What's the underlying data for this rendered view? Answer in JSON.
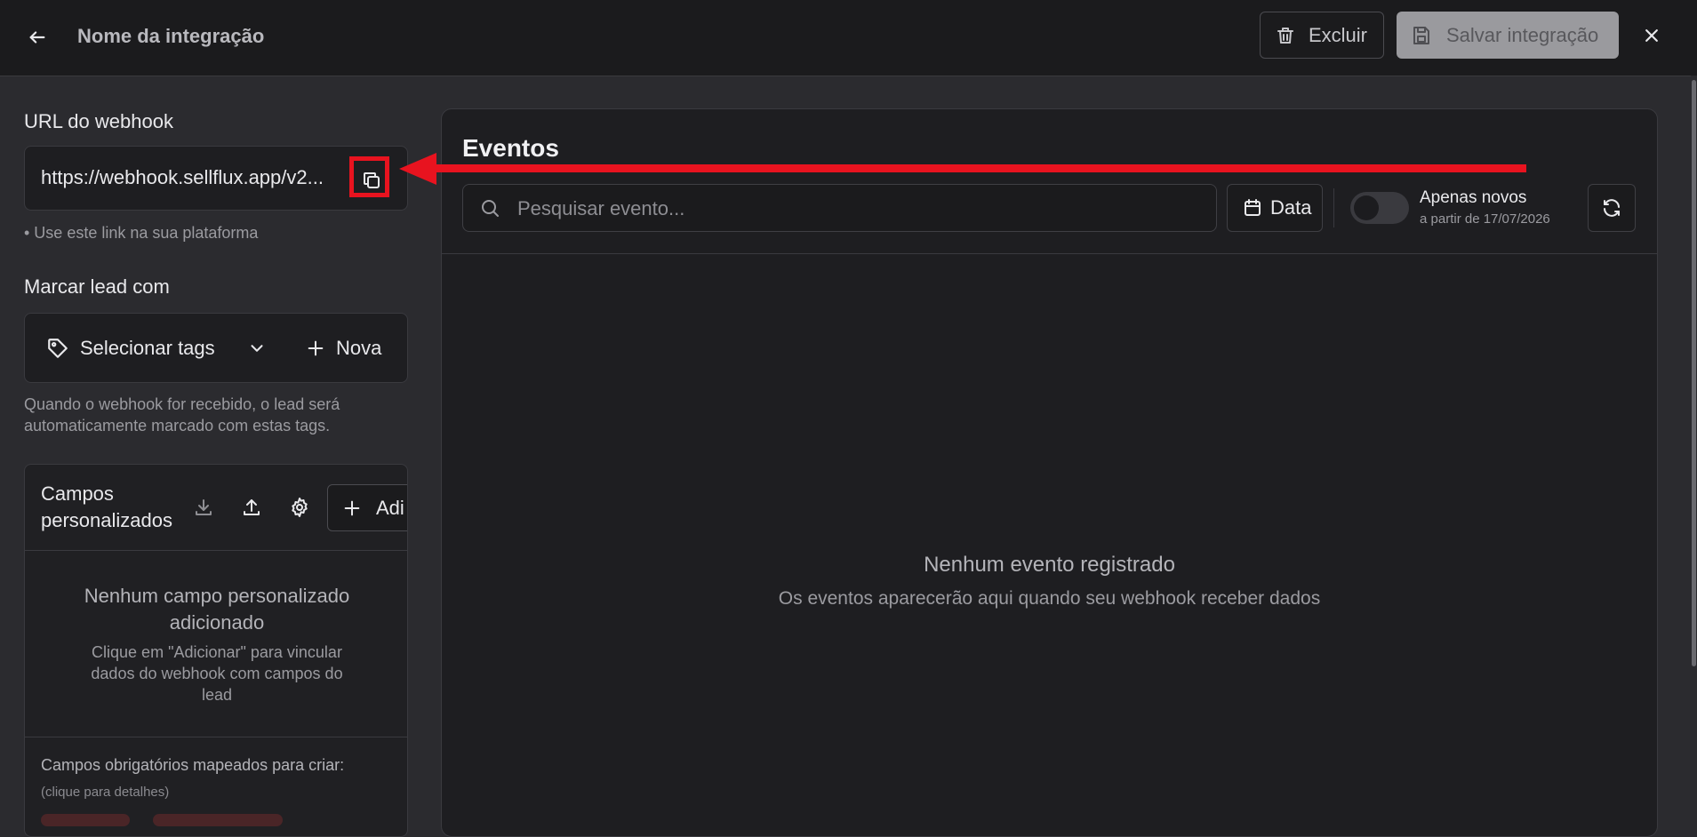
{
  "header": {
    "title": "Nome da integração",
    "delete_label": "Excluir",
    "save_label": "Salvar integração"
  },
  "webhook": {
    "label": "URL do webhook",
    "url": "https://webhook.sellflux.app/v2...",
    "hint": "• Use este link na sua plataforma"
  },
  "tags": {
    "label": "Marcar lead com",
    "select_label": "Selecionar tags",
    "new_label": "Nova",
    "hint_line1": "Quando o webhook for recebido, o lead será",
    "hint_line2": "automaticamente marcado com estas tags."
  },
  "custom_fields": {
    "title_line1": "Campos",
    "title_line2": "personalizados",
    "add_label": "Adi",
    "empty_title_line1": "Nenhum campo personalizado",
    "empty_title_line2": "adicionado",
    "empty_sub_line1": "Clique em \"Adicionar\" para vincular",
    "empty_sub_line2": "dados do webhook com campos do",
    "empty_sub_line3": "lead",
    "required_text": "Campos obrigatórios mapeados para criar:",
    "required_hint": "(clique para detalhes)"
  },
  "events": {
    "title": "Eventos",
    "search_placeholder": "Pesquisar evento...",
    "date_label": "Data",
    "toggle_label": "Apenas novos",
    "toggle_sub": "a partir de 17/07/2026",
    "toggle_on": false,
    "empty_title": "Nenhum evento registrado",
    "empty_sub": "Os eventos aparecerão aqui quando seu webhook receber dados"
  },
  "annotation_color": "#e8131f"
}
